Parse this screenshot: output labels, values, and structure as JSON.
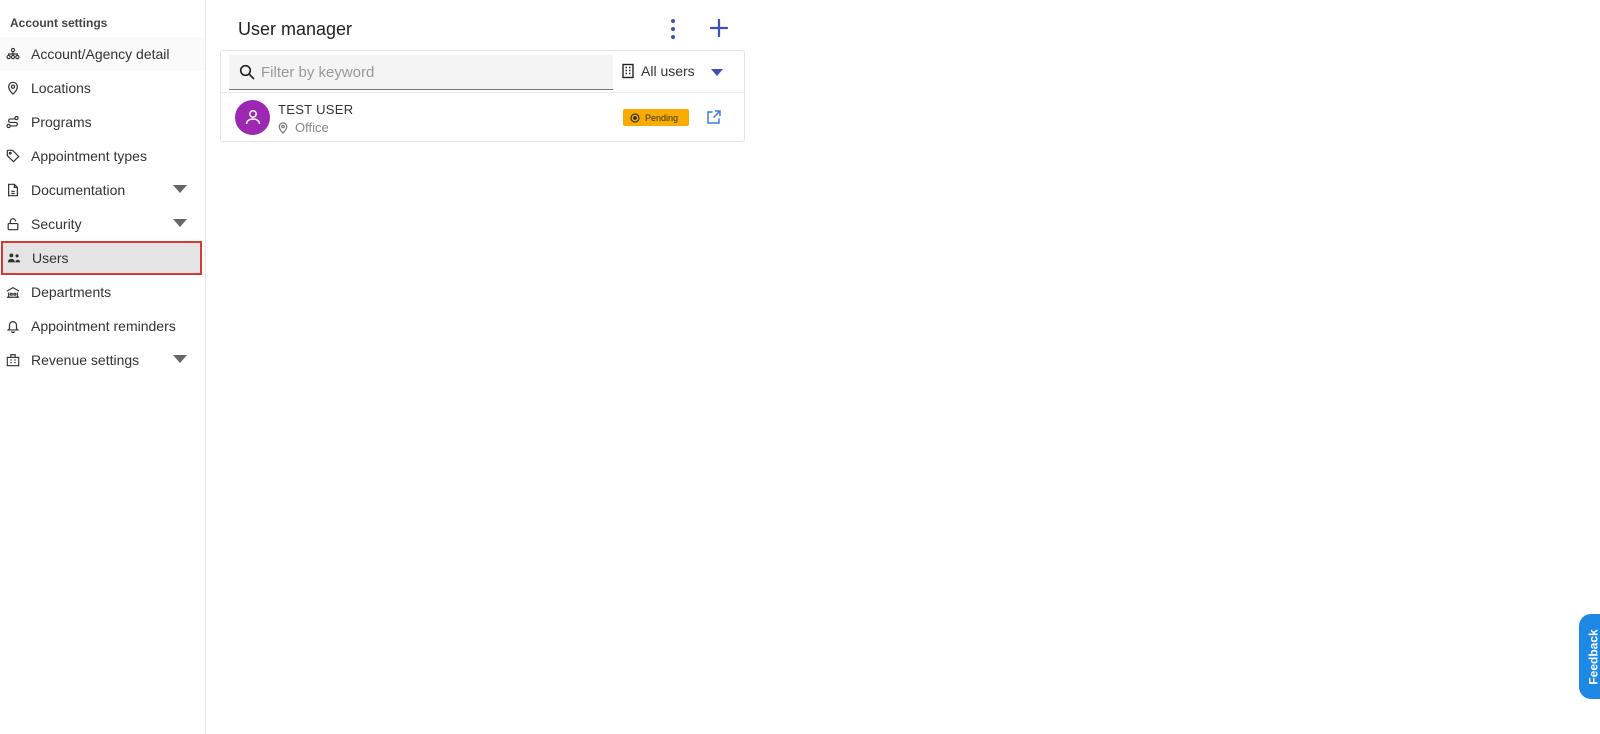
{
  "sidebar": {
    "title": "Account settings",
    "items": [
      {
        "label": "Account/Agency detail",
        "icon": "org-chart-icon"
      },
      {
        "label": "Locations",
        "icon": "location-pin-icon"
      },
      {
        "label": "Programs",
        "icon": "route-icon"
      },
      {
        "label": "Appointment types",
        "icon": "tags-icon"
      },
      {
        "label": "Documentation",
        "icon": "document-icon",
        "expandable": true
      },
      {
        "label": "Security",
        "icon": "unlock-icon",
        "expandable": true
      },
      {
        "label": "Users",
        "icon": "users-icon",
        "active": true
      },
      {
        "label": "Departments",
        "icon": "departments-icon"
      },
      {
        "label": "Appointment reminders",
        "icon": "bell-icon"
      },
      {
        "label": "Revenue settings",
        "icon": "building-icon",
        "expandable": true
      }
    ]
  },
  "main": {
    "title": "User manager",
    "filter": {
      "placeholder": "Filter by keyword",
      "value": ""
    },
    "users_filter": {
      "selected": "All users"
    },
    "users": [
      {
        "name": "TEST USER",
        "location": "Office",
        "status": "Pending"
      }
    ]
  },
  "feedback": {
    "label": "Feedback"
  },
  "colors": {
    "accent": "#3f51b5",
    "avatar": "#9c27b0",
    "pending_badge": "#f9ab00",
    "feedback": "#1e88e5",
    "active_border": "#d23a32"
  }
}
